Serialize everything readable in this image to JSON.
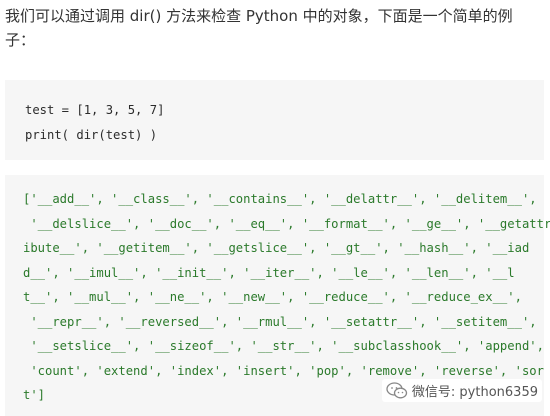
{
  "intro": {
    "line1": "我们可以通过调用 dir() 方法来检查 Python 中的对象，下面是一个简单的例",
    "line2": "子："
  },
  "code_input": [
    "test = [1, 3, 5, 7]",
    "print( dir(test) )"
  ],
  "code_output": [
    "['__add__', '__class__', '__contains__', '__delattr__', '__delitem__',",
    " '__delslice__', '__doc__', '__eq__', '__format__', '__ge__', '__getattr",
    "ibute__', '__getitem__', '__getslice__', '__gt__', '__hash__', '__iad",
    "d__', '__imul__', '__init__', '__iter__', '__le__', '__len__', '__l",
    "t__', '__mul__', '__ne__', '__new__', '__reduce__', '__reduce_ex__',",
    " '__repr__', '__reversed__', '__rmul__', '__setattr__', '__setitem__',",
    " '__setslice__', '__sizeof__', '__str__', '__subclasshook__', 'append',",
    " 'count', 'extend', 'index', 'insert', 'pop', 'remove', 'reverse', 'sor",
    "t']"
  ],
  "watermark": {
    "icon": "wechat-icon",
    "text": "微信号: python6359"
  },
  "colors": {
    "output_text": "#2b7a2b",
    "code_bg": "#f6f6f6",
    "body_text": "#333333"
  }
}
